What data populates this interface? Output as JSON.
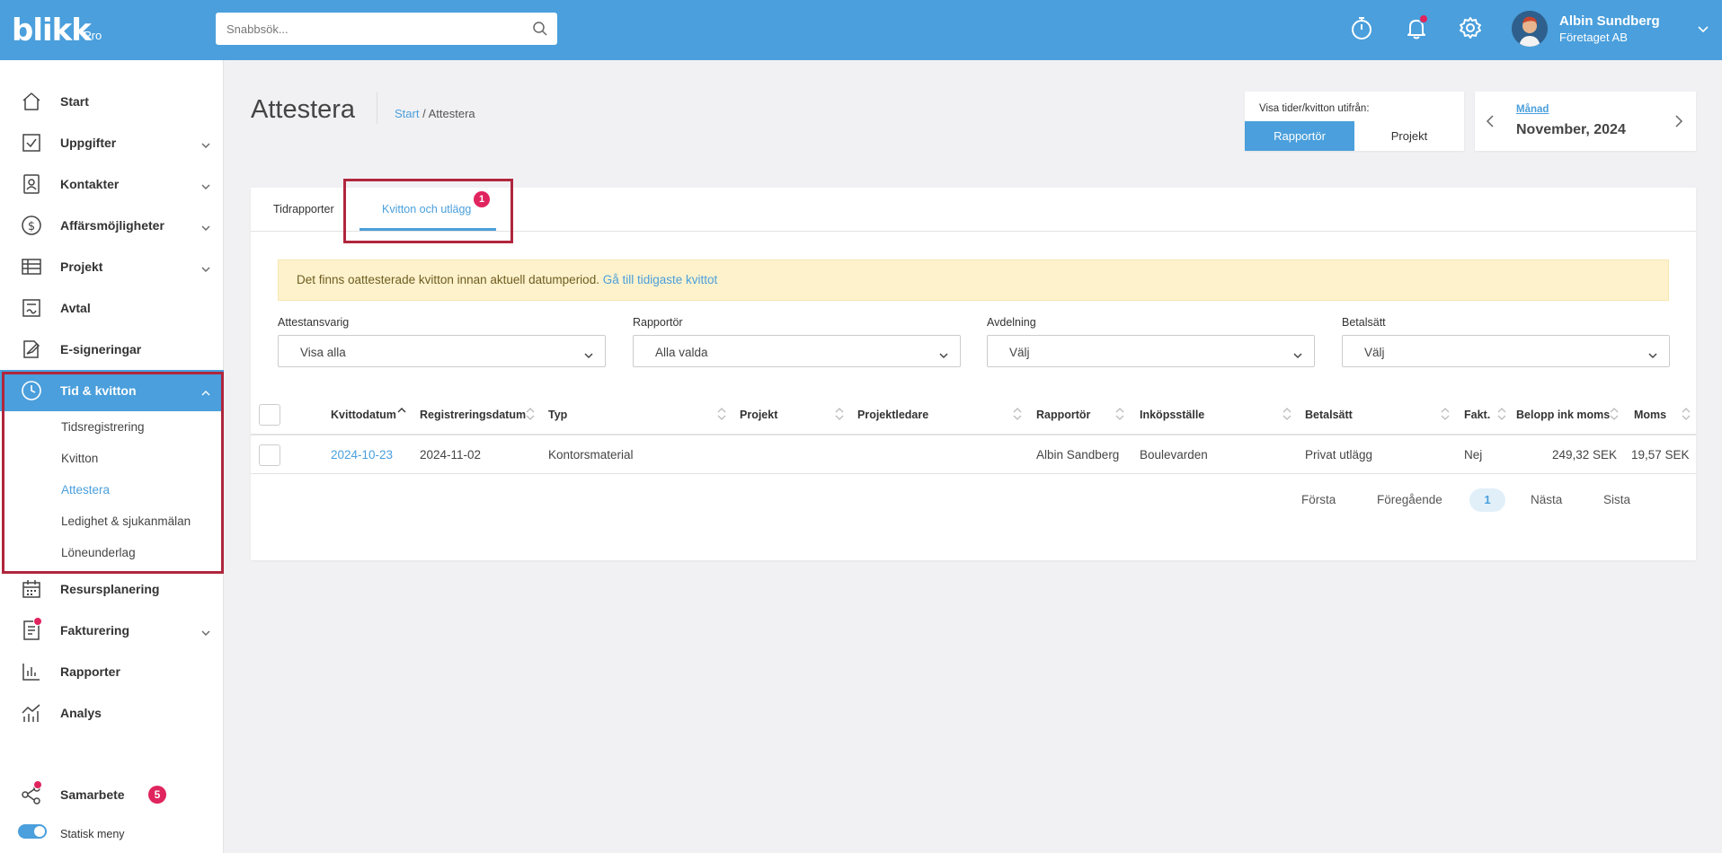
{
  "app": {
    "logo": "blikk",
    "logo_suffix": "Pro",
    "search_placeholder": "Snabbsök...",
    "user_name": "Albin Sundberg",
    "user_company": "Företaget AB"
  },
  "colors": {
    "brand": "#4a9fdc",
    "alert_bg": "#fdf2cc",
    "badge": "#e0245e",
    "highlight": "#b0263d"
  },
  "sidebar": {
    "items": [
      {
        "label": "Start",
        "icon": "home-icon"
      },
      {
        "label": "Uppgifter",
        "icon": "checkbox-icon"
      },
      {
        "label": "Kontakter",
        "icon": "contact-icon"
      },
      {
        "label": "Affärsmöjligheter",
        "icon": "dollar-icon"
      },
      {
        "label": "Projekt",
        "icon": "table-icon"
      },
      {
        "label": "Avtal",
        "icon": "contract-icon"
      },
      {
        "label": "E-signeringar",
        "icon": "signature-icon"
      },
      {
        "label": "Tid & kvitton",
        "icon": "clock-icon"
      },
      {
        "label": "Resursplanering",
        "icon": "calendar-icon"
      },
      {
        "label": "Fakturering",
        "icon": "invoice-icon"
      },
      {
        "label": "Rapporter",
        "icon": "bar-chart-icon"
      },
      {
        "label": "Analys",
        "icon": "analytics-icon"
      }
    ],
    "sub_items": [
      "Tidsregistrering",
      "Kvitton",
      "Attestera",
      "Ledighet & sjukanmälan",
      "Löneunderlag"
    ],
    "collab_label": "Samarbete",
    "collab_badge": "5",
    "static_menu_label": "Statisk meny"
  },
  "page": {
    "title": "Attestera",
    "breadcrumb_home": "Start",
    "breadcrumb_sep": "/",
    "breadcrumb_current": "Attestera"
  },
  "view_toggle": {
    "label": "Visa tider/kvitton utifrån:",
    "option_a": "Rapportör",
    "option_b": "Projekt"
  },
  "period": {
    "unit": "Månad",
    "value": "November, 2024"
  },
  "tabs": [
    {
      "label": "Tidrapporter"
    },
    {
      "label": "Kvitton och utlägg",
      "badge": "1"
    }
  ],
  "alert": {
    "text": "Det finns oattesterade kvitton innan aktuell datumperiod.",
    "link": "Gå till tidigaste kvittot"
  },
  "filters": [
    {
      "label": "Attestansvarig",
      "value": "Visa alla"
    },
    {
      "label": "Rapportör",
      "value": "Alla valda"
    },
    {
      "label": "Avdelning",
      "value": "Välj"
    },
    {
      "label": "Betalsätt",
      "value": "Välj"
    }
  ],
  "table": {
    "columns": [
      "Kvittodatum",
      "Registreringsdatum",
      "Typ",
      "Projekt",
      "Projektledare",
      "Rapportör",
      "Inköpsställe",
      "Betalsätt",
      "Fakt.",
      "Belopp ink moms",
      "Moms"
    ],
    "rows": [
      [
        "2024-10-23",
        "2024-11-02",
        "Kontorsmaterial",
        "",
        "",
        "Albin Sandberg",
        "Boulevarden",
        "Privat utlägg",
        "Nej",
        "249,32 SEK",
        "19,57 SEK"
      ]
    ]
  },
  "pagination": {
    "first": "Första",
    "prev": "Föregående",
    "current": "1",
    "next": "Nästa",
    "last": "Sista"
  }
}
